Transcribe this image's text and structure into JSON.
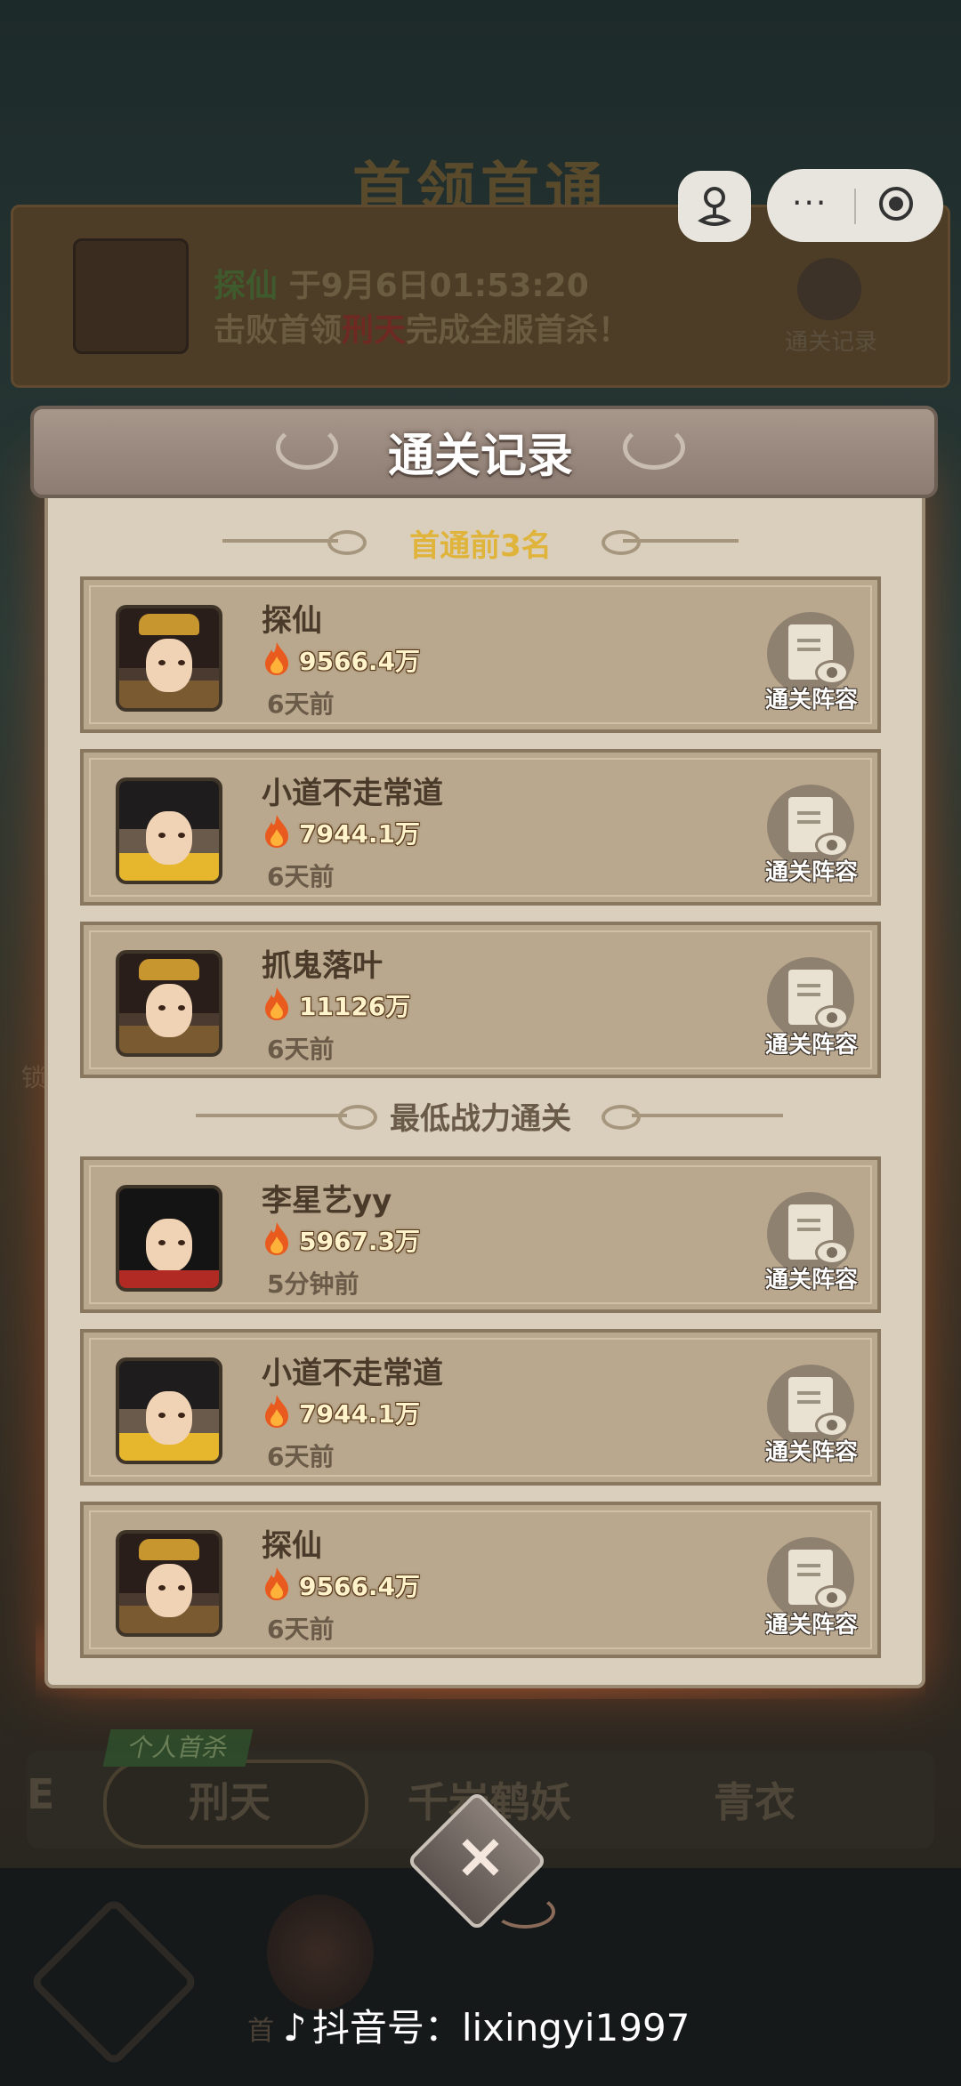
{
  "background": {
    "page_title": "首领首通",
    "banner": {
      "player": "探仙",
      "date_text": "于9月6日01:53:20",
      "line2_prefix": "击败首领",
      "boss": "刑天",
      "line2_suffix": "完成全服首杀！",
      "record_label": "通关记录"
    },
    "tabs": {
      "left_partial": "E",
      "personal_tag": "个人首杀",
      "items": [
        "刑天",
        "千岩鹤妖",
        "青衣"
      ]
    },
    "side_char": "锁",
    "bottom_partial": "首"
  },
  "capsule": {
    "more": "···"
  },
  "modal": {
    "title": "通关记录",
    "section1": "首通前3名",
    "section2": "最低战力通关",
    "view_label": "通关阵容",
    "first_clears": [
      {
        "name": "探仙",
        "power": "9566.4万",
        "time": "6天前",
        "avatar": "female-crown-avatar"
      },
      {
        "name": "小道不走常道",
        "power": "7944.1万",
        "time": "6天前",
        "avatar": "male-yellow-robe-avatar"
      },
      {
        "name": "抓鬼落叶",
        "power": "11126万",
        "time": "6天前",
        "avatar": "female-crown-avatar"
      }
    ],
    "lowest_power": [
      {
        "name": "李星艺yy",
        "power": "5967.3万",
        "time": "5分钟前",
        "avatar": "female-long-hair-avatar"
      },
      {
        "name": "小道不走常道",
        "power": "7944.1万",
        "time": "6天前",
        "avatar": "male-yellow-robe-avatar"
      },
      {
        "name": "探仙",
        "power": "9566.4万",
        "time": "6天前",
        "avatar": "female-crown-avatar"
      }
    ]
  },
  "close_button": {
    "label": "×"
  },
  "watermark": {
    "prefix": "抖音号：",
    "id": "lixingyi1997"
  },
  "colors": {
    "accent_section1": "#e0b43a",
    "section2": "#6a5a48",
    "boss_red": "#c0392b",
    "fire": "#e85a1e"
  }
}
